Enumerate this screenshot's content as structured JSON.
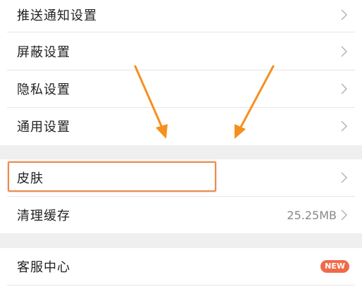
{
  "settings": {
    "items": [
      {
        "label": "推送通知设置"
      },
      {
        "label": "屏蔽设置"
      },
      {
        "label": "隐私设置"
      },
      {
        "label": "通用设置"
      }
    ],
    "skin": {
      "label": "皮肤"
    },
    "cache": {
      "label": "清理缓存",
      "value": "25.25MB"
    },
    "service": {
      "label": "客服中心",
      "badge": "NEW"
    }
  },
  "colors": {
    "annotation_arrow": "#f5901e",
    "highlight_border": "#e98a50",
    "badge_bg": "#f06a4a",
    "section_gap": "#efefef"
  }
}
